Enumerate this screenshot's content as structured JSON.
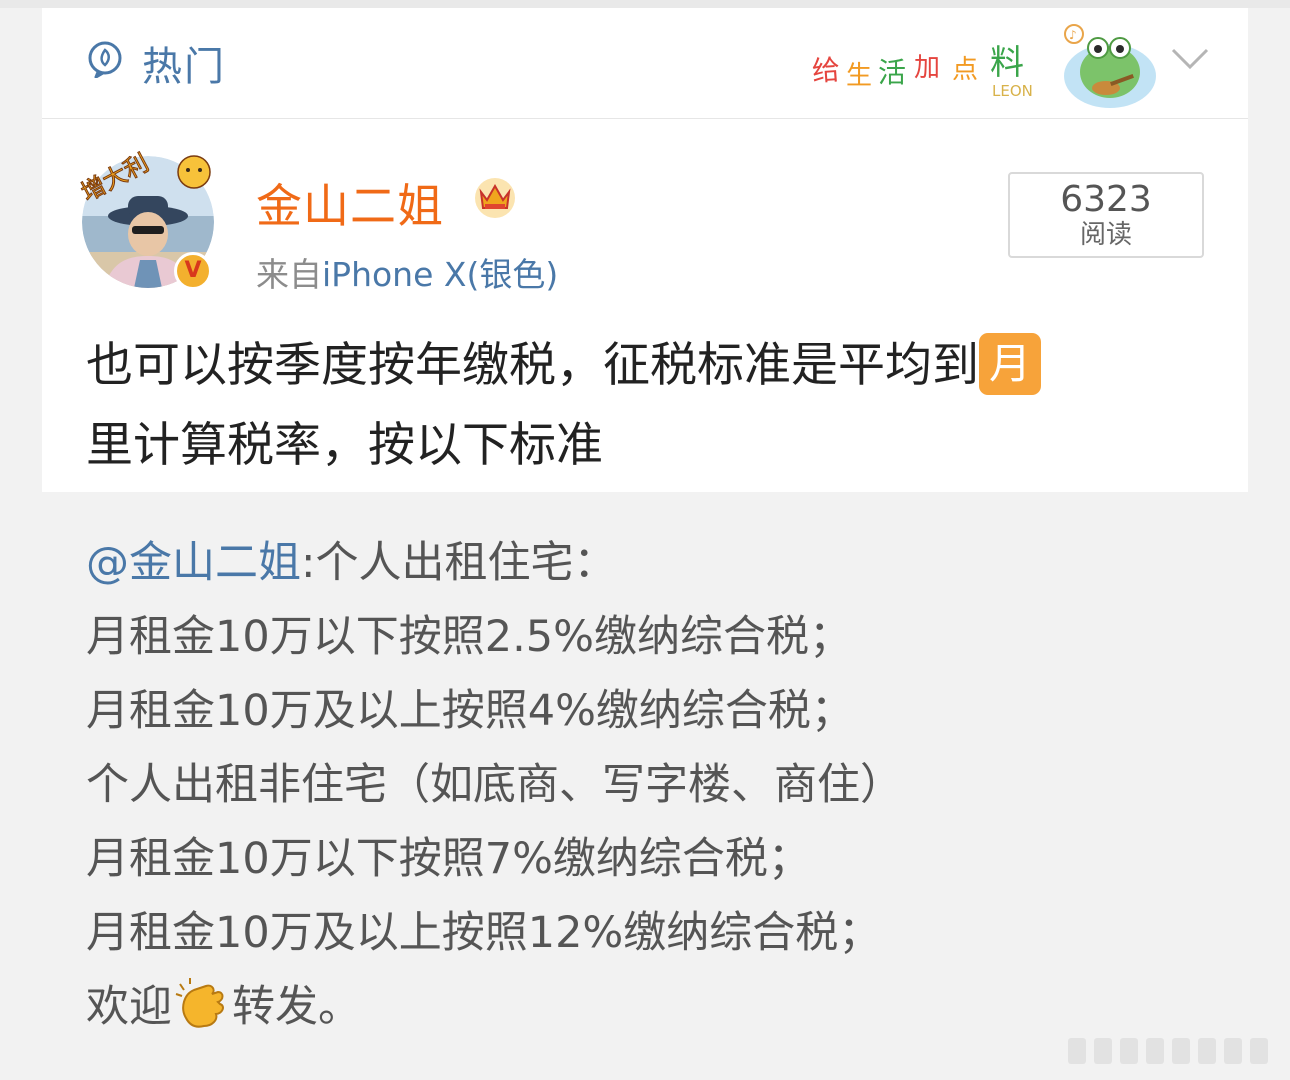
{
  "header": {
    "hot_label": "热门",
    "deco_text": "给生活加点料",
    "deco_sub": "LEON"
  },
  "user": {
    "name": "金山二姐",
    "source_prefix": "来自",
    "device": "iPhone X(银色)",
    "avatar_sticker": "增大利",
    "verified_badge": "V"
  },
  "reads": {
    "count": "6323",
    "label": "阅读"
  },
  "post": {
    "text_before_emoji": "也可以按季度按年缴税，征税标准是平均到",
    "emoji": "月",
    "text_after_emoji": "里计算税率，按以下标准"
  },
  "quote": {
    "mention": "@金山二姐",
    "first_line_rest": ":个人出租住宅：",
    "lines": [
      "月租金10万以下按照2.5%缴纳综合税；",
      "月租金10万及以上按照4%缴纳综合税；",
      "个人出租非住宅（如底商、写字楼、商住）",
      "月租金10万以下按照7%缴纳综合税；",
      "月租金10万及以上按照12%缴纳综合税；"
    ],
    "last_before_emoji": "欢迎",
    "last_after_emoji": "转发。"
  },
  "colors": {
    "link": "#4a78a8",
    "username": "#f06a17",
    "quote_bg": "#f2f2f2"
  }
}
